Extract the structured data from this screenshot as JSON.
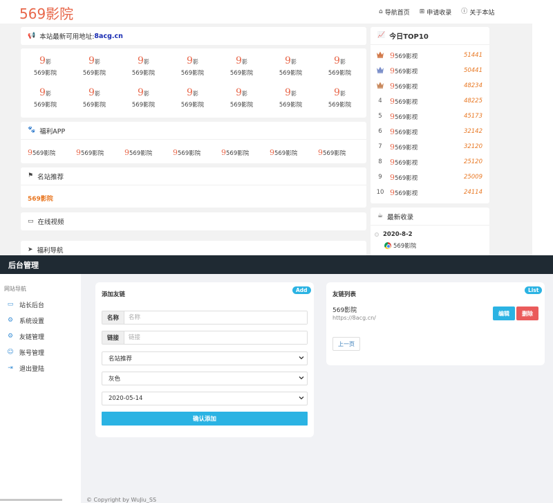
{
  "site": {
    "logo": "569影院",
    "nav": [
      "导航首页",
      "申请收录",
      "关于本站"
    ]
  },
  "notice": {
    "text": "本站最新可用地址:",
    "url": "8acg.cn"
  },
  "grid": {
    "logo_num": "9",
    "logo_char": "影",
    "rows": [
      [
        "569影院",
        "569影院",
        "569影院",
        "569影院",
        "569影院",
        "569影院",
        "569影院"
      ],
      [
        "569影院",
        "569影院",
        "569影院",
        "569影院",
        "569影院",
        "569影院",
        "569影院"
      ]
    ]
  },
  "app": {
    "title": "福利APP",
    "items": [
      "569影院",
      "569影院",
      "569影院",
      "569影院",
      "569影院",
      "569影院",
      "569影院"
    ]
  },
  "recommend": {
    "title": "名站推荐",
    "link": "569影院"
  },
  "video": {
    "title": "在线视频"
  },
  "welfare": {
    "title": "福利导航"
  },
  "top10": {
    "title": "今日TOP10",
    "rows": [
      {
        "rank": "1",
        "name": "569影视",
        "value": "51441",
        "crown": "#d27a4b"
      },
      {
        "rank": "2",
        "name": "569影视",
        "value": "50441",
        "crown": "#7b8fc9"
      },
      {
        "rank": "3",
        "name": "569影视",
        "value": "48234",
        "crown": "#c98a5e"
      },
      {
        "rank": "4",
        "name": "569影视",
        "value": "48225"
      },
      {
        "rank": "5",
        "name": "569影视",
        "value": "45173"
      },
      {
        "rank": "6",
        "name": "569影视",
        "value": "32142"
      },
      {
        "rank": "7",
        "name": "569影视",
        "value": "32120"
      },
      {
        "rank": "8",
        "name": "569影视",
        "value": "25120"
      },
      {
        "rank": "9",
        "name": "569影视",
        "value": "25009"
      },
      {
        "rank": "10",
        "name": "569影视",
        "value": "24114"
      }
    ]
  },
  "latest": {
    "title": "最新收录",
    "date": "2020-8-2",
    "item": "569影院"
  },
  "admin": {
    "title": "后台管理",
    "sidebar_title": "网站导航",
    "sidebar": [
      {
        "label": "站长后台",
        "icon": "monitor-icon"
      },
      {
        "label": "系统设置",
        "icon": "gear-icon"
      },
      {
        "label": "友链管理",
        "icon": "gear-icon"
      },
      {
        "label": "账号管理",
        "icon": "user-icon"
      },
      {
        "label": "退出登陆",
        "icon": "logout-icon"
      }
    ],
    "add": {
      "title": "添加友链",
      "badge": "Add",
      "name_label": "名称",
      "name_placeholder": "名称",
      "link_label": "链接",
      "link_placeholder": "链接",
      "category": "名站推荐",
      "color": "灰色",
      "date": "2020-05-14",
      "submit": "确认添加"
    },
    "list": {
      "title": "友链列表",
      "badge": "List",
      "item_name": "569影院",
      "item_url": "https://8acg.cn/",
      "edit": "编辑",
      "delete": "删除",
      "prev": "上一页"
    },
    "footer": "© Copyright by WuJiu_SS"
  }
}
